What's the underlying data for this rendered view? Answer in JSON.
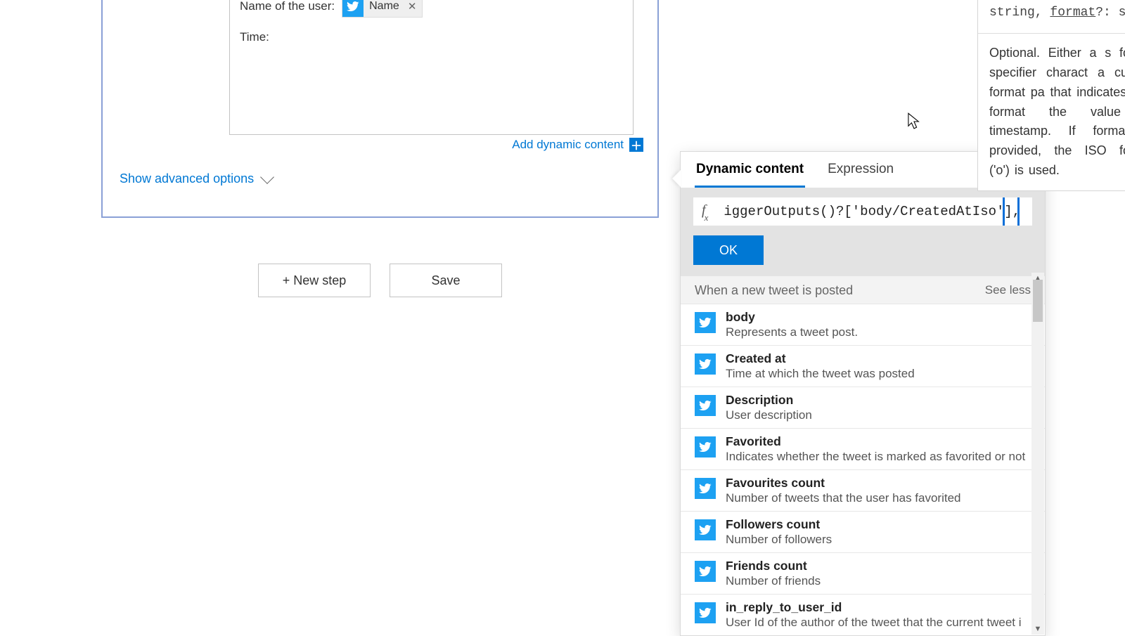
{
  "editor": {
    "line1_label": "Name of the user:",
    "chip_label": "Name",
    "line2": "Time:",
    "add_dynamic": "Add dynamic content",
    "advanced": "Show advanced options"
  },
  "buttons": {
    "new_step": "+ New step",
    "save": "Save"
  },
  "panel": {
    "tab_dynamic": "Dynamic content",
    "tab_expression": "Expression",
    "fx_symbol": "f",
    "expression_text": "iggerOutputs()?['body/CreatedAtIso'],",
    "ok": "OK",
    "section_title": "When a new tweet is posted",
    "see_less": "See less",
    "items": [
      {
        "title": "body",
        "desc": "Represents a tweet post."
      },
      {
        "title": "Created at",
        "desc": "Time at which the tweet was posted"
      },
      {
        "title": "Description",
        "desc": "User description"
      },
      {
        "title": "Favorited",
        "desc": "Indicates whether the tweet is marked as favorited or not"
      },
      {
        "title": "Favourites count",
        "desc": "Number of tweets that the user has favorited"
      },
      {
        "title": "Followers count",
        "desc": "Number of followers"
      },
      {
        "title": "Friends count",
        "desc": "Number of friends"
      },
      {
        "title": "in_reply_to_user_id",
        "desc": "User Id of the author of the tweet that the current tweet i"
      }
    ]
  },
  "tooltip": {
    "signature_pre": "string, ",
    "signature_mid": "format",
    "signature_post": "?: str",
    "description": "Optional. Either a s format specifier charact a custom format pa that indicates how format the value of timestamp. If format is provided, the ISO format ('o') is used."
  }
}
